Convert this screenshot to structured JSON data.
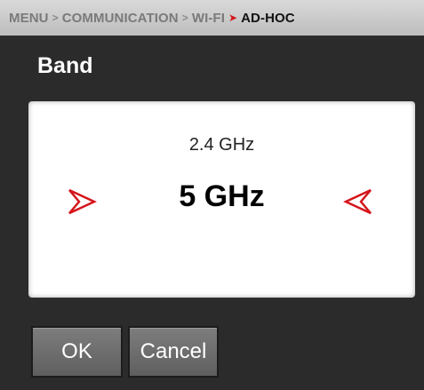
{
  "breadcrumb": {
    "items": [
      "MENU",
      "COMMUNICATION",
      "WI-FI",
      "AD-HOC"
    ],
    "separator": ">"
  },
  "page": {
    "title": "Band"
  },
  "selector": {
    "previous_option": "2.4 GHz",
    "current_option": "5 GHz",
    "prev_arrow_icon": "chevron-left-outline-icon",
    "next_arrow_icon": "chevron-right-outline-icon"
  },
  "buttons": {
    "ok_label": "OK",
    "cancel_label": "Cancel"
  },
  "colors": {
    "accent": "#d4141b",
    "background": "#2b2b2b",
    "button": "#6e6e6e"
  }
}
